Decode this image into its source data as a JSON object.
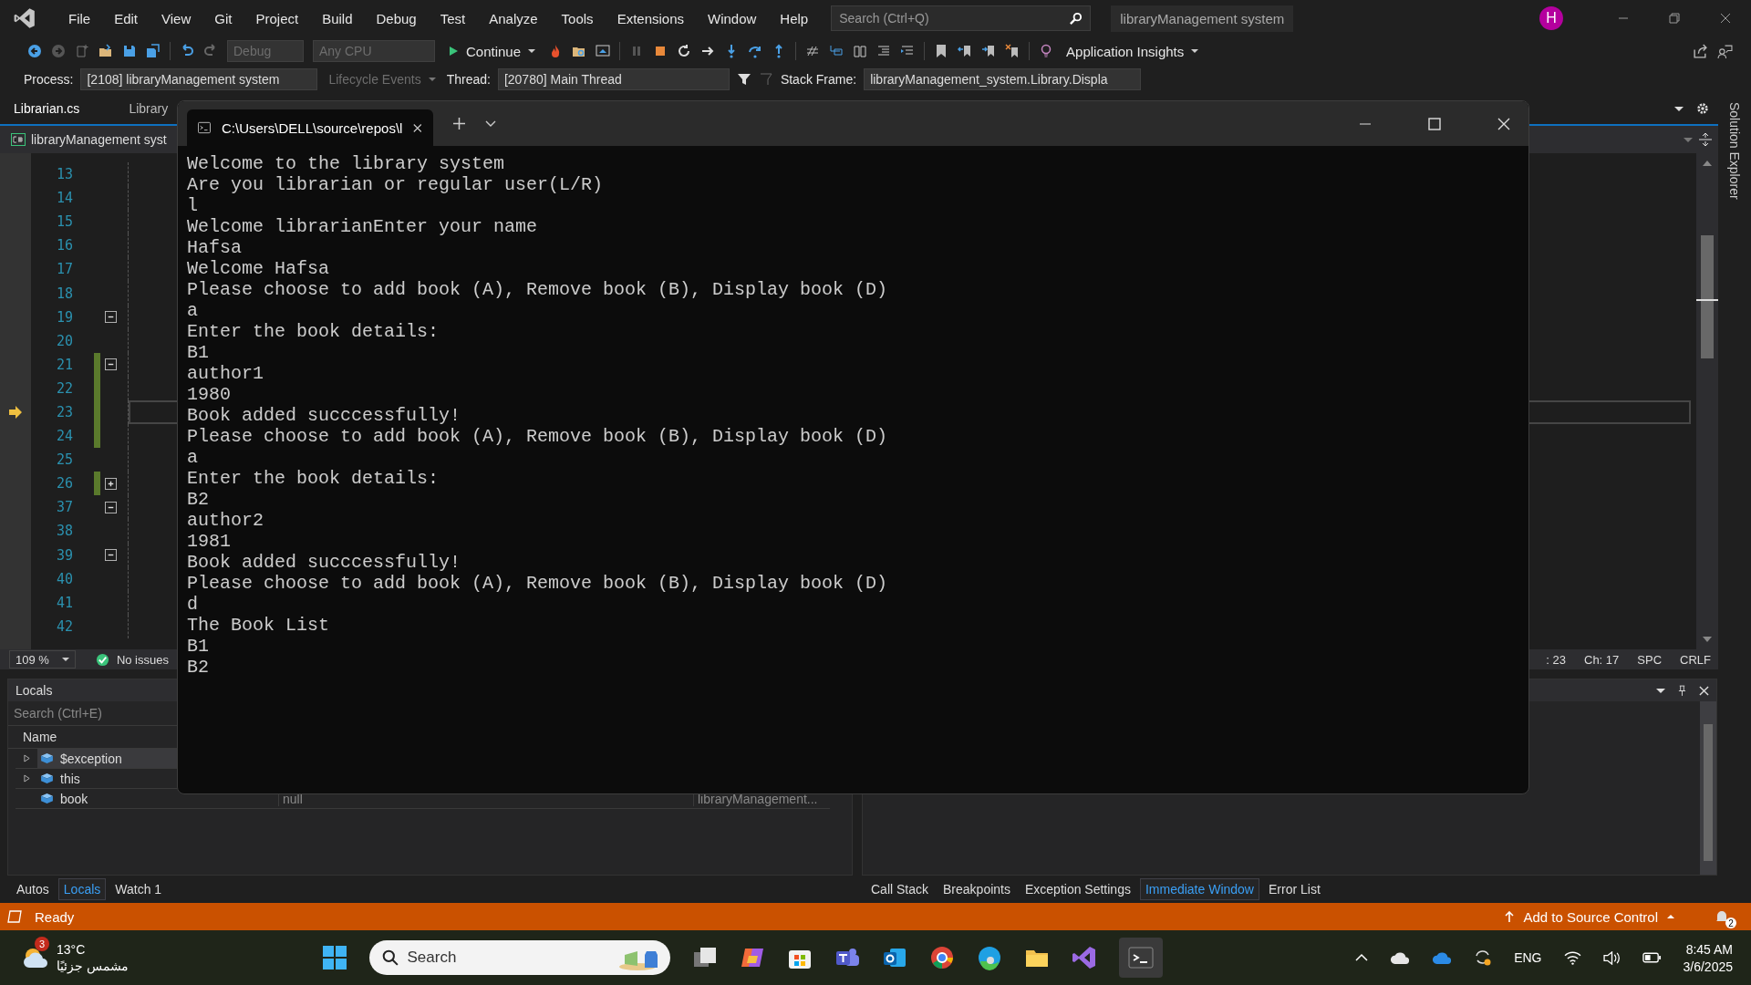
{
  "menu_bar": {
    "items": [
      "File",
      "Edit",
      "View",
      "Git",
      "Project",
      "Build",
      "Debug",
      "Test",
      "Analyze",
      "Tools",
      "Extensions",
      "Window",
      "Help"
    ],
    "search": {
      "placeholder": "Search (Ctrl+Q)"
    },
    "solution_name": "libraryManagement system",
    "avatar": "H"
  },
  "toolbar": {
    "configuration": "Debug",
    "platform": "Any CPU",
    "continue": "Continue",
    "insights": "Application Insights"
  },
  "debug_location": {
    "process_label": "Process:",
    "process": "[2108] libraryManagement system",
    "lifecycle": "Lifecycle Events",
    "thread_label": "Thread:",
    "thread": "[20780] Main Thread",
    "stack_frame_label": "Stack Frame:",
    "stack_frame": "libraryManagement_system.Library.Displa"
  },
  "document_tabs": [
    {
      "label": "Librarian.cs",
      "selected": true
    },
    {
      "label": "Library",
      "selected": false
    }
  ],
  "navigation_bar": {
    "project": "libraryManagement syst"
  },
  "editor": {
    "lines": [
      {
        "number": "13",
        "changed": false,
        "current": false
      },
      {
        "number": "14",
        "changed": false,
        "current": false
      },
      {
        "number": "15",
        "changed": false,
        "current": false
      },
      {
        "number": "16",
        "changed": false,
        "current": false
      },
      {
        "number": "17",
        "changed": false,
        "current": false
      },
      {
        "number": "18",
        "changed": false,
        "current": false
      },
      {
        "number": "19",
        "fold": {
          "collapsed": false
        },
        "changed": false,
        "current": false
      },
      {
        "number": "20",
        "changed": false,
        "current": false
      },
      {
        "number": "21",
        "fold": {
          "collapsed": false
        },
        "changed": true,
        "current": false
      },
      {
        "number": "22",
        "changed": true,
        "current": false
      },
      {
        "number": "23",
        "changed": true,
        "current": true
      },
      {
        "number": "24",
        "changed": true,
        "current": false
      },
      {
        "number": "25",
        "changed": false,
        "current": false
      },
      {
        "number": "26",
        "fold": {
          "collapsed": true
        },
        "changed": true,
        "current": false
      },
      {
        "number": "37",
        "fold": {
          "collapsed": false
        },
        "changed": false,
        "current": false
      },
      {
        "number": "38",
        "changed": false,
        "current": false
      },
      {
        "number": "39",
        "fold": {
          "collapsed": false
        },
        "changed": false,
        "current": false
      },
      {
        "number": "40",
        "changed": false,
        "current": false
      },
      {
        "number": "41",
        "changed": false,
        "current": false
      },
      {
        "number": "42",
        "changed": false,
        "current": false
      }
    ]
  },
  "editor_status": {
    "zoom": "109 %",
    "issues": "No issues",
    "line": ": 23",
    "column": "Ch: 17",
    "indent": "SPC",
    "line_ending": "CRLF"
  },
  "locals": {
    "title": "Locals",
    "search": {
      "placeholder": "Search (Ctrl+E)"
    },
    "columns": [
      "Name"
    ],
    "rows": [
      {
        "name": "$exception",
        "expandable": true,
        "selected": true
      },
      {
        "name": "this",
        "expandable": true,
        "selected": false
      },
      {
        "name": "book",
        "expandable": false,
        "selected": false,
        "value": "null",
        "type": "libraryManagement..."
      }
    ]
  },
  "left_panel_tabs": [
    {
      "label": "Autos",
      "selected": false
    },
    {
      "label": "Locals",
      "selected": true
    },
    {
      "label": "Watch 1",
      "selected": false
    }
  ],
  "right_panel_tabs": [
    {
      "label": "Call Stack",
      "selected": false
    },
    {
      "label": "Breakpoints",
      "selected": false
    },
    {
      "label": "Exception Settings",
      "selected": false
    },
    {
      "label": "Immediate Window",
      "selected": true
    },
    {
      "label": "Error List",
      "selected": false
    }
  ],
  "side_strip": {
    "label": "Solution Explorer"
  },
  "terminal": {
    "tab_title": "C:\\Users\\DELL\\source\\repos\\l",
    "lines": [
      "Welcome to the library system",
      "Are you librarian or regular user(L/R)",
      "l",
      "Welcome librarianEnter your name",
      "Hafsa",
      "Welcome Hafsa",
      "Please choose to add book (A), Remove book (B), Display book (D)",
      "a",
      "Enter the book details:",
      "B1",
      "author1",
      "1980",
      "Book added succcessfully!",
      "Please choose to add book (A), Remove book (B), Display book (D)",
      "a",
      "Enter the book details:",
      "B2",
      "author2",
      "1981",
      "Book added succcessfully!",
      "Please choose to add book (A), Remove book (B), Display book (D)",
      "d",
      "The Book List",
      "B1",
      "B2"
    ]
  },
  "status_bar": {
    "text": "Ready",
    "source_control": "Add to Source Control",
    "notifications": "2"
  },
  "taskbar": {
    "weather": {
      "badge": "3",
      "temperature": "13°C",
      "condition": "مشمس جزئيًا"
    },
    "search": {
      "placeholder": "Search"
    },
    "language": "ENG",
    "time": "8:45 AM",
    "date": "3/6/2025"
  }
}
